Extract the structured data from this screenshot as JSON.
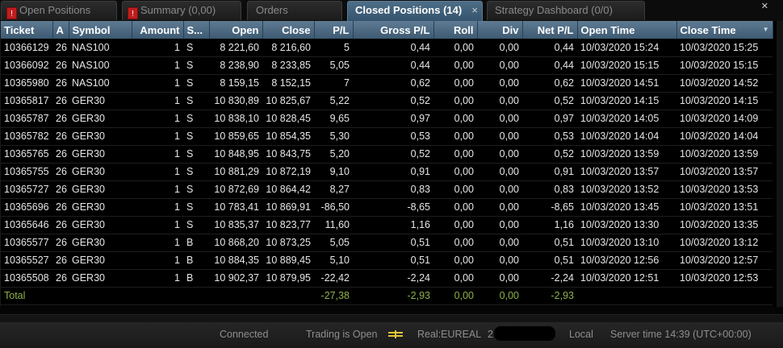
{
  "tabs": [
    {
      "label": "Open Positions",
      "warning": true,
      "active": false
    },
    {
      "label": "Summary (0,00)",
      "warning": true,
      "active": false
    },
    {
      "label": "Orders",
      "warning": false,
      "active": false
    },
    {
      "label": "Closed Positions (14)",
      "warning": false,
      "active": true
    },
    {
      "label": "Strategy Dashboard (0/0)",
      "warning": false,
      "active": false
    }
  ],
  "tab_close_glyph": "×",
  "window_close_glyph": "✕",
  "warning_glyph": "!",
  "columns": [
    "Ticket",
    "A",
    "Symbol",
    "Amount",
    "S...",
    "Open",
    "Close",
    "P/L",
    "Gross P/L",
    "Roll",
    "Div",
    "Net P/L",
    "Open Time",
    "Close Time"
  ],
  "sort_indicator": "▼",
  "rows": [
    [
      "10366129",
      "26",
      "NAS100",
      "1",
      "S",
      "8 221,60",
      "8 216,60",
      "5",
      "0,44",
      "0,00",
      "0,00",
      "0,44",
      "10/03/2020 15:24",
      "10/03/2020 15:25"
    ],
    [
      "10366092",
      "26",
      "NAS100",
      "1",
      "S",
      "8 238,90",
      "8 233,85",
      "5,05",
      "0,44",
      "0,00",
      "0,00",
      "0,44",
      "10/03/2020 15:15",
      "10/03/2020 15:15"
    ],
    [
      "10365980",
      "26",
      "NAS100",
      "1",
      "S",
      "8 159,15",
      "8 152,15",
      "7",
      "0,62",
      "0,00",
      "0,00",
      "0,62",
      "10/03/2020 14:51",
      "10/03/2020 14:52"
    ],
    [
      "10365817",
      "26",
      "GER30",
      "1",
      "S",
      "10 830,89",
      "10 825,67",
      "5,22",
      "0,52",
      "0,00",
      "0,00",
      "0,52",
      "10/03/2020 14:15",
      "10/03/2020 14:15"
    ],
    [
      "10365787",
      "26",
      "GER30",
      "1",
      "S",
      "10 838,10",
      "10 828,45",
      "9,65",
      "0,97",
      "0,00",
      "0,00",
      "0,97",
      "10/03/2020 14:05",
      "10/03/2020 14:09"
    ],
    [
      "10365782",
      "26",
      "GER30",
      "1",
      "S",
      "10 859,65",
      "10 854,35",
      "5,30",
      "0,53",
      "0,00",
      "0,00",
      "0,53",
      "10/03/2020 14:04",
      "10/03/2020 14:04"
    ],
    [
      "10365765",
      "26",
      "GER30",
      "1",
      "S",
      "10 848,95",
      "10 843,75",
      "5,20",
      "0,52",
      "0,00",
      "0,00",
      "0,52",
      "10/03/2020 13:59",
      "10/03/2020 13:59"
    ],
    [
      "10365755",
      "26",
      "GER30",
      "1",
      "S",
      "10 881,29",
      "10 872,19",
      "9,10",
      "0,91",
      "0,00",
      "0,00",
      "0,91",
      "10/03/2020 13:57",
      "10/03/2020 13:57"
    ],
    [
      "10365727",
      "26",
      "GER30",
      "1",
      "S",
      "10 872,69",
      "10 864,42",
      "8,27",
      "0,83",
      "0,00",
      "0,00",
      "0,83",
      "10/03/2020 13:52",
      "10/03/2020 13:53"
    ],
    [
      "10365696",
      "26",
      "GER30",
      "1",
      "S",
      "10 783,41",
      "10 869,91",
      "-86,50",
      "-8,65",
      "0,00",
      "0,00",
      "-8,65",
      "10/03/2020 13:45",
      "10/03/2020 13:51"
    ],
    [
      "10365646",
      "26",
      "GER30",
      "1",
      "S",
      "10 835,37",
      "10 823,77",
      "11,60",
      "1,16",
      "0,00",
      "0,00",
      "1,16",
      "10/03/2020 13:30",
      "10/03/2020 13:35"
    ],
    [
      "10365577",
      "26",
      "GER30",
      "1",
      "B",
      "10 868,20",
      "10 873,25",
      "5,05",
      "0,51",
      "0,00",
      "0,00",
      "0,51",
      "10/03/2020 13:10",
      "10/03/2020 13:12"
    ],
    [
      "10365527",
      "26",
      "GER30",
      "1",
      "B",
      "10 884,35",
      "10 889,45",
      "5,10",
      "0,51",
      "0,00",
      "0,00",
      "0,51",
      "10/03/2020 12:56",
      "10/03/2020 12:57"
    ],
    [
      "10365508",
      "26",
      "GER30",
      "1",
      "B",
      "10 902,37",
      "10 879,95",
      "-22,42",
      "-2,24",
      "0,00",
      "0,00",
      "-2,24",
      "10/03/2020 12:51",
      "10/03/2020 12:53"
    ]
  ],
  "total": [
    "Total",
    "",
    "",
    "",
    "",
    "",
    "",
    "-27,38",
    "-2,93",
    "0,00",
    "0,00",
    "-2,93",
    "",
    ""
  ],
  "status": {
    "connection": "Connected",
    "trading": "Trading is Open",
    "account": "Real:EUREAL",
    "account_prefix": "2",
    "timezone_mode": "Local",
    "server_time": "Server time 14:39 (UTC+00:00)"
  },
  "colors": {
    "header_top": "#5e7b93",
    "header_bottom": "#3d5a72",
    "active_tab": "#4e6d86",
    "total_text": "#8fb14a",
    "warning_icon": "#c01e1e",
    "trading_icon": "#e0c53a"
  }
}
